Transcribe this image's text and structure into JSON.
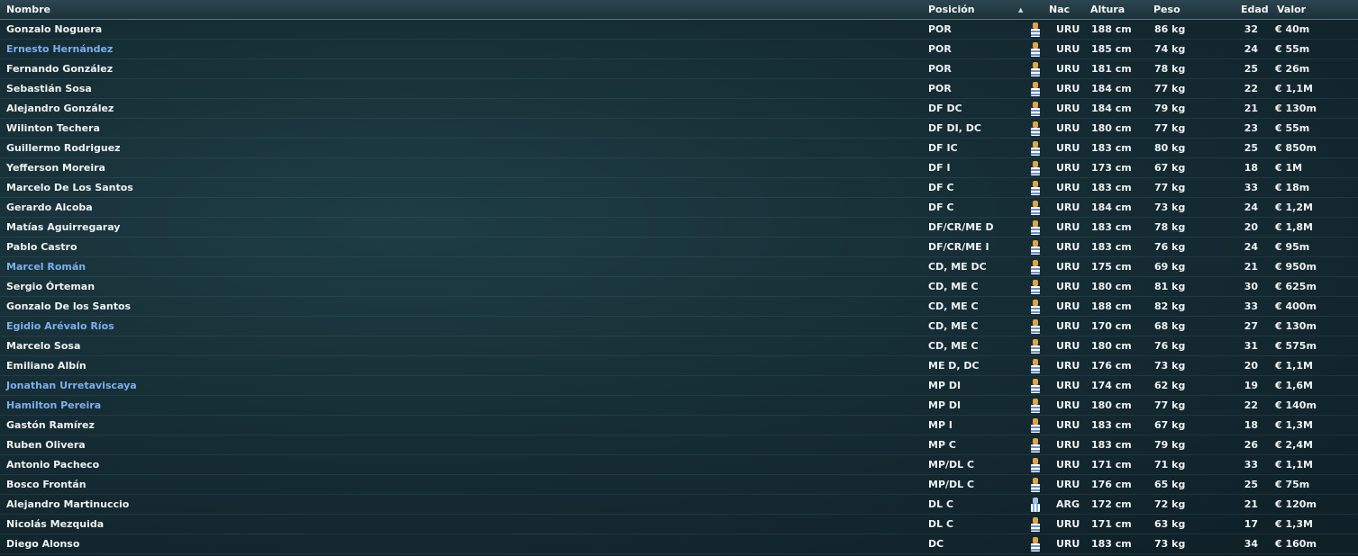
{
  "header": {
    "name": "Nombre",
    "position": "Posición",
    "sort_indicator": "▲",
    "nationality": "Nac",
    "height": "Altura",
    "weight": "Peso",
    "age": "Edad",
    "value": "Valor"
  },
  "colors": {
    "link": "#7ab0ee",
    "text": "#eef2f3"
  },
  "players": [
    {
      "name": "Gonzalo Noguera",
      "link": false,
      "pos": "POR",
      "flag": "uruguay-flag-icon",
      "nac": "URU",
      "height": "188 cm",
      "weight": "86 kg",
      "age": "32",
      "value": "€ 40m"
    },
    {
      "name": "Ernesto Hernández",
      "link": true,
      "pos": "POR",
      "flag": "uruguay-flag-icon",
      "nac": "URU",
      "height": "185 cm",
      "weight": "74 kg",
      "age": "24",
      "value": "€ 55m"
    },
    {
      "name": "Fernando González",
      "link": false,
      "pos": "POR",
      "flag": "uruguay-flag-icon",
      "nac": "URU",
      "height": "181 cm",
      "weight": "78 kg",
      "age": "25",
      "value": "€ 26m"
    },
    {
      "name": "Sebastián Sosa",
      "link": false,
      "pos": "POR",
      "flag": "uruguay-flag-icon",
      "nac": "URU",
      "height": "184 cm",
      "weight": "77 kg",
      "age": "22",
      "value": "€ 1,1M"
    },
    {
      "name": "Alejandro González",
      "link": false,
      "pos": "DF DC",
      "flag": "uruguay-flag-icon",
      "nac": "URU",
      "height": "184 cm",
      "weight": "79 kg",
      "age": "21",
      "value": "€ 130m"
    },
    {
      "name": "Wilinton Techera",
      "link": false,
      "pos": "DF DI, DC",
      "flag": "uruguay-flag-icon",
      "nac": "URU",
      "height": "180 cm",
      "weight": "77 kg",
      "age": "23",
      "value": "€ 55m"
    },
    {
      "name": "Guillermo Rodriguez",
      "link": false,
      "pos": "DF IC",
      "flag": "uruguay-flag-icon",
      "nac": "URU",
      "height": "183 cm",
      "weight": "80 kg",
      "age": "25",
      "value": "€ 850m"
    },
    {
      "name": "Yefferson Moreira",
      "link": false,
      "pos": "DF I",
      "flag": "uruguay-flag-icon",
      "nac": "URU",
      "height": "173 cm",
      "weight": "67 kg",
      "age": "18",
      "value": "€ 1M"
    },
    {
      "name": "Marcelo De Los Santos",
      "link": false,
      "pos": "DF C",
      "flag": "uruguay-flag-icon",
      "nac": "URU",
      "height": "183 cm",
      "weight": "77 kg",
      "age": "33",
      "value": "€ 18m"
    },
    {
      "name": "Gerardo Alcoba",
      "link": false,
      "pos": "DF C",
      "flag": "uruguay-flag-icon",
      "nac": "URU",
      "height": "184 cm",
      "weight": "73 kg",
      "age": "24",
      "value": "€ 1,2M"
    },
    {
      "name": "Matías Aguirregaray",
      "link": false,
      "pos": "DF/CR/ME D",
      "flag": "uruguay-flag-icon",
      "nac": "URU",
      "height": "183 cm",
      "weight": "78 kg",
      "age": "20",
      "value": "€ 1,8M"
    },
    {
      "name": "Pablo Castro",
      "link": false,
      "pos": "DF/CR/ME I",
      "flag": "uruguay-flag-icon",
      "nac": "URU",
      "height": "183 cm",
      "weight": "76 kg",
      "age": "24",
      "value": "€ 95m"
    },
    {
      "name": "Marcel Román",
      "link": true,
      "pos": "CD, ME DC",
      "flag": "uruguay-flag-icon",
      "nac": "URU",
      "height": "175 cm",
      "weight": "69 kg",
      "age": "21",
      "value": "€ 950m"
    },
    {
      "name": "Sergio Órteman",
      "link": false,
      "pos": "CD, ME C",
      "flag": "uruguay-flag-icon",
      "nac": "URU",
      "height": "180 cm",
      "weight": "81 kg",
      "age": "30",
      "value": "€ 625m"
    },
    {
      "name": "Gonzalo De los Santos",
      "link": false,
      "pos": "CD, ME C",
      "flag": "uruguay-flag-icon",
      "nac": "URU",
      "height": "188 cm",
      "weight": "82 kg",
      "age": "33",
      "value": "€ 400m"
    },
    {
      "name": "Egidio Arévalo Ríos",
      "link": true,
      "pos": "CD, ME C",
      "flag": "uruguay-flag-icon",
      "nac": "URU",
      "height": "170 cm",
      "weight": "68 kg",
      "age": "27",
      "value": "€ 130m"
    },
    {
      "name": "Marcelo Sosa",
      "link": false,
      "pos": "CD, ME C",
      "flag": "uruguay-flag-icon",
      "nac": "URU",
      "height": "180 cm",
      "weight": "76 kg",
      "age": "31",
      "value": "€ 575m"
    },
    {
      "name": "Emiliano Albín",
      "link": false,
      "pos": "ME D, DC",
      "flag": "uruguay-flag-icon",
      "nac": "URU",
      "height": "176 cm",
      "weight": "73 kg",
      "age": "20",
      "value": "€ 1,1M"
    },
    {
      "name": "Jonathan Urretaviscaya",
      "link": true,
      "pos": "MP DI",
      "flag": "uruguay-flag-icon",
      "nac": "URU",
      "height": "174 cm",
      "weight": "62 kg",
      "age": "19",
      "value": "€ 1,6M"
    },
    {
      "name": "Hamilton Pereira",
      "link": true,
      "pos": "MP DI",
      "flag": "uruguay-flag-icon",
      "nac": "URU",
      "height": "180 cm",
      "weight": "77 kg",
      "age": "22",
      "value": "€ 140m"
    },
    {
      "name": "Gastón Ramírez",
      "link": false,
      "pos": "MP I",
      "flag": "uruguay-flag-icon",
      "nac": "URU",
      "height": "183 cm",
      "weight": "67 kg",
      "age": "18",
      "value": "€ 1,3M"
    },
    {
      "name": "Ruben Olivera",
      "link": false,
      "pos": "MP C",
      "flag": "uruguay-flag-icon",
      "nac": "URU",
      "height": "183 cm",
      "weight": "79 kg",
      "age": "26",
      "value": "€ 2,4M"
    },
    {
      "name": "Antonio Pacheco",
      "link": false,
      "pos": "MP/DL C",
      "flag": "uruguay-flag-icon",
      "nac": "URU",
      "height": "171 cm",
      "weight": "71 kg",
      "age": "33",
      "value": "€ 1,1M"
    },
    {
      "name": "Bosco Frontán",
      "link": false,
      "pos": "MP/DL C",
      "flag": "uruguay-flag-icon",
      "nac": "URU",
      "height": "176 cm",
      "weight": "65 kg",
      "age": "25",
      "value": "€ 75m"
    },
    {
      "name": "Alejandro Martinuccio",
      "link": false,
      "pos": "DL C",
      "flag": "argentina-flag-icon",
      "nac": "ARG",
      "height": "172 cm",
      "weight": "72 kg",
      "age": "21",
      "value": "€ 120m"
    },
    {
      "name": "Nicolás Mezquida",
      "link": false,
      "pos": "DL C",
      "flag": "uruguay-flag-icon",
      "nac": "URU",
      "height": "171 cm",
      "weight": "63 kg",
      "age": "17",
      "value": "€ 1,3M"
    },
    {
      "name": "Diego Alonso",
      "link": false,
      "pos": "DC",
      "flag": "uruguay-flag-icon",
      "nac": "URU",
      "height": "183 cm",
      "weight": "73 kg",
      "age": "34",
      "value": "€ 160m"
    }
  ]
}
